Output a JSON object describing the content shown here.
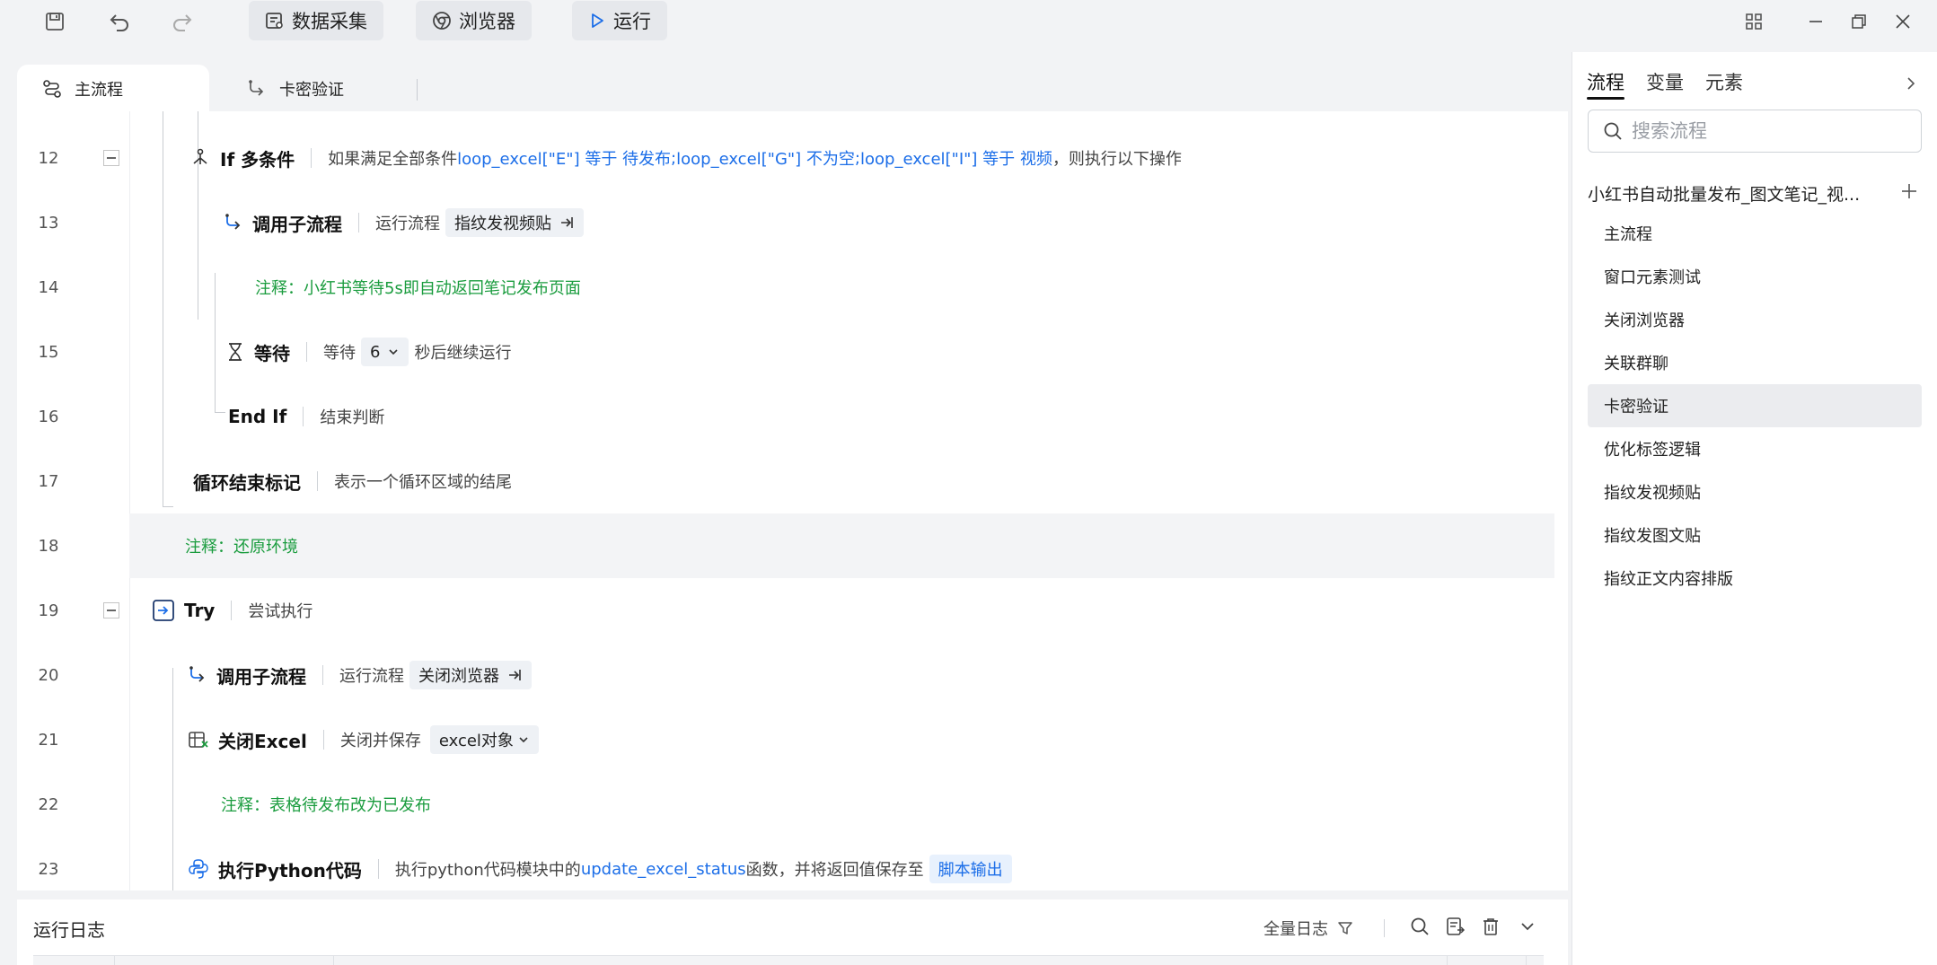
{
  "toolbar": {
    "data_collect": "数据采集",
    "browser": "浏览器",
    "run": "运行"
  },
  "tabs": [
    {
      "label": "主流程",
      "active": true
    },
    {
      "label": "卡密验证",
      "active": false
    }
  ],
  "rows": {
    "r12": {
      "num": "12",
      "kw": "If 多条件",
      "pre": "如果满足全部条件 ",
      "cond1": "loop_excel[\"E\"] 等于 待发布",
      "sep1": "; ",
      "cond2": "loop_excel[\"G\"] 不为空",
      "sep2": " ; ",
      "cond3": "loop_excel[\"I\"] 等于 视频",
      "post": "，则执行以下操作"
    },
    "r13": {
      "num": "13",
      "kw": "调用子流程",
      "desc": "运行流程",
      "chip": "指纹发视频贴"
    },
    "r14": {
      "num": "14",
      "note": "注释：小红书等待5s即自动返回笔记发布页面"
    },
    "r15": {
      "num": "15",
      "kw": "等待",
      "desc": "等待",
      "value": "6",
      "post": "秒后继续运行"
    },
    "r16": {
      "num": "16",
      "kw": "End If",
      "desc": "结束判断"
    },
    "r17": {
      "num": "17",
      "kw": "循环结束标记",
      "desc": "表示一个循环区域的结尾"
    },
    "r18": {
      "num": "18",
      "note": "注释：还原环境"
    },
    "r19": {
      "num": "19",
      "kw": "Try",
      "desc": "尝试执行"
    },
    "r20": {
      "num": "20",
      "kw": "调用子流程",
      "desc": "运行流程",
      "chip": "关闭浏览器"
    },
    "r21": {
      "num": "21",
      "kw": "关闭Excel",
      "desc": "关闭并保存",
      "chip": "excel对象"
    },
    "r22": {
      "num": "22",
      "note": "注释：表格待发布改为已发布"
    },
    "r23": {
      "num": "23",
      "kw": "执行Python代码",
      "pre": "执行python代码模块中的",
      "func": "update_excel_status",
      "post": "函数，并将返回值保存至",
      "chip": "脚本输出"
    }
  },
  "log": {
    "title": "运行日志",
    "filter": "全量日志"
  },
  "right_panel": {
    "tabs": [
      "流程",
      "变量",
      "元素"
    ],
    "search_placeholder": "搜索流程",
    "project": "小红书自动批量发布_图文笔记_视...",
    "flows": [
      "主流程",
      "窗口元素测试",
      "关闭浏览器",
      "关联群聊",
      "卡密验证",
      "优化标签逻辑",
      "指纹发视频贴",
      "指纹发图文贴",
      "指纹正文内容排版"
    ],
    "selected_flow": "卡密验证"
  },
  "icons": [
    "save-icon",
    "undo-icon",
    "redo-icon",
    "data-collect-icon",
    "chrome-icon",
    "play-icon",
    "apps-grid-icon",
    "minimize-icon",
    "restore-icon",
    "close-icon",
    "flow-icon",
    "subflow-icon",
    "if-icon",
    "hourglass-icon",
    "try-icon",
    "excel-close-icon",
    "python-icon",
    "jump-icon",
    "chevron-down-icon",
    "search-icon",
    "filter-icon",
    "export-icon",
    "trash-icon",
    "plus-icon",
    "chevron-right-icon"
  ],
  "colors": {
    "accent": "#1c6ee8",
    "comment": "#1a9c3e",
    "background": "#f2f3f5"
  }
}
